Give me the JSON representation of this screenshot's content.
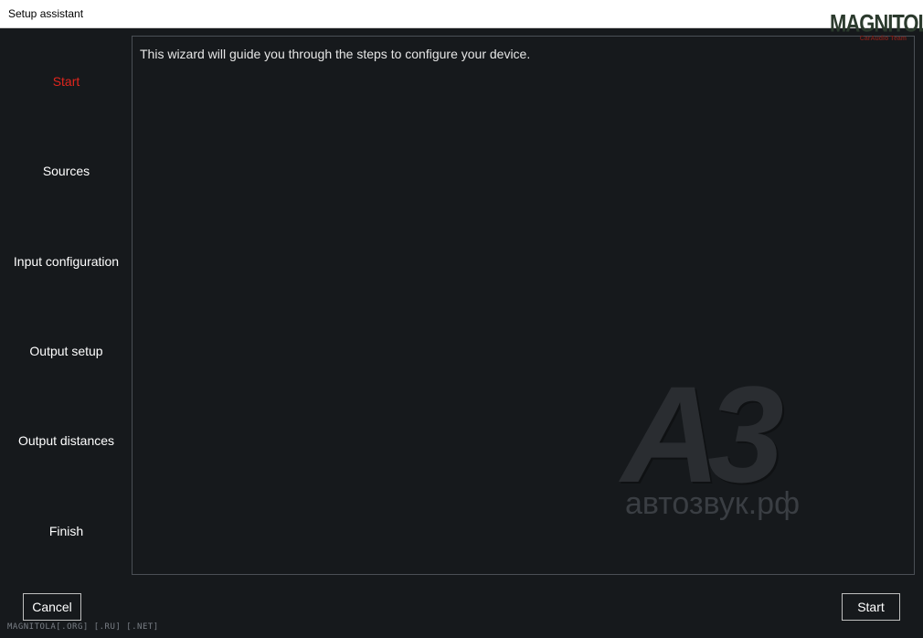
{
  "window": {
    "title": "Setup assistant"
  },
  "steps": [
    {
      "label": "Start",
      "active": true
    },
    {
      "label": "Sources",
      "active": false
    },
    {
      "label": "Input configuration",
      "active": false
    },
    {
      "label": "Output setup",
      "active": false
    },
    {
      "label": "Output distances",
      "active": false
    },
    {
      "label": "Finish",
      "active": false
    }
  ],
  "content": {
    "message": "This wizard will guide you through the steps to configure your device."
  },
  "buttons": {
    "cancel_label": "Cancel",
    "start_label": "Start"
  },
  "watermarks": {
    "top_logo": "MAGNITOLA",
    "top_logo_sub": "CarAudio Team",
    "center_logo": "A3",
    "center_logo_sub": "автозвук.рф",
    "footer": "MAGNITOLA[.ORG] [.RU] [.NET]"
  },
  "colors": {
    "background": "#16191c",
    "active_step": "#e0261d",
    "text": "#ffffff",
    "panel_border": "#4a4f55"
  }
}
